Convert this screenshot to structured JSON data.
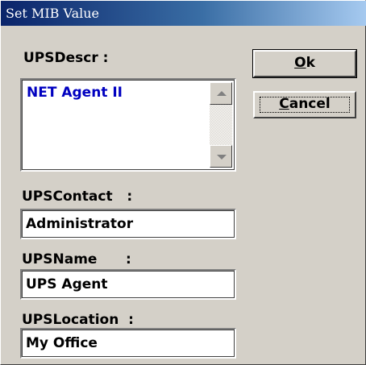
{
  "window": {
    "title": "Set MIB Value"
  },
  "descr": {
    "label": "UPSDescr :",
    "value": "NET Agent II"
  },
  "contact": {
    "label": "UPSContact   :",
    "value": "Administrator"
  },
  "name": {
    "label": "UPSName      :",
    "value": "UPS Agent"
  },
  "location": {
    "label": "UPSLocation  :",
    "value": "My Office"
  },
  "buttons": {
    "ok_mnemonic": "O",
    "ok_rest": "k",
    "cancel_mnemonic": "C",
    "cancel_rest": "ancel"
  },
  "icons": {
    "scroll_up": "triangle-up",
    "scroll_down": "triangle-down"
  }
}
